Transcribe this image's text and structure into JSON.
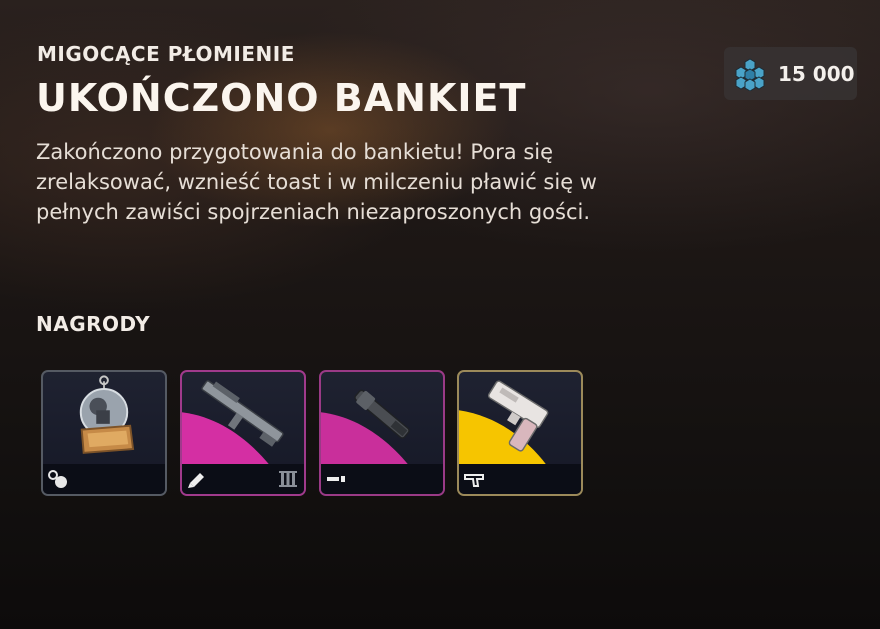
{
  "header": {
    "subtitle": "MIGOCĄCE PŁOMIENIE",
    "title": "UKOŃCZONO BANKIET",
    "description": "Zakończono przygotowania do bankietu! Pora się zrelaksować, wznieść toast i w milczeniu pławić się w pełnych zawiści spojrzeniach niezaproszonych gości."
  },
  "currency": {
    "icon": "hexagon-cluster-icon",
    "amount": "15 000",
    "color": "#4aa3c8"
  },
  "rewards": {
    "label": "NAGRODY",
    "items": [
      {
        "name": "snow-globe-charm",
        "type_icon": "charm-icon",
        "rarity_color": "#555a63"
      },
      {
        "name": "rifle-weapon-skin",
        "type_icon": "weapon-skin-icon",
        "tier_icon": "tier-three-icon",
        "rarity_color": "#d42fa3"
      },
      {
        "name": "grip-attachment-skin",
        "type_icon": "attachment-icon",
        "rarity_color": "#d42fa3"
      },
      {
        "name": "pistol-weapon-skin",
        "type_icon": "pistol-icon",
        "rarity_color": "#f6c500"
      }
    ]
  }
}
